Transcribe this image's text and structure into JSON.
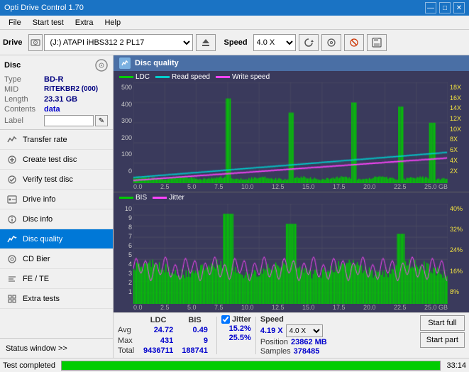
{
  "titlebar": {
    "title": "Opti Drive Control 1.70",
    "min_btn": "—",
    "max_btn": "□",
    "close_btn": "✕"
  },
  "menubar": {
    "items": [
      "File",
      "Start test",
      "Extra",
      "Help"
    ]
  },
  "toolbar": {
    "drive_label": "Drive",
    "drive_value": "(J:)  ATAPI iHBS312  2 PL17",
    "speed_label": "Speed",
    "speed_value": "4.0 X"
  },
  "disc": {
    "title": "Disc",
    "type_label": "Type",
    "type_value": "BD-R",
    "mid_label": "MID",
    "mid_value": "RITEKBR2 (000)",
    "length_label": "Length",
    "length_value": "23.31 GB",
    "contents_label": "Contents",
    "contents_value": "data",
    "label_label": "Label"
  },
  "nav": {
    "items": [
      {
        "id": "transfer-rate",
        "label": "Transfer rate",
        "active": false
      },
      {
        "id": "create-test-disc",
        "label": "Create test disc",
        "active": false
      },
      {
        "id": "verify-test-disc",
        "label": "Verify test disc",
        "active": false
      },
      {
        "id": "drive-info",
        "label": "Drive info",
        "active": false
      },
      {
        "id": "disc-info",
        "label": "Disc info",
        "active": false
      },
      {
        "id": "disc-quality",
        "label": "Disc quality",
        "active": true
      },
      {
        "id": "cd-bier",
        "label": "CD Bier",
        "active": false
      },
      {
        "id": "fe-te",
        "label": "FE / TE",
        "active": false
      },
      {
        "id": "extra-tests",
        "label": "Extra tests",
        "active": false
      }
    ]
  },
  "status_window": {
    "label": "Status window >>"
  },
  "disc_quality": {
    "title": "Disc quality"
  },
  "chart_top": {
    "legend": [
      {
        "id": "ldc",
        "label": "LDC",
        "color": "#00cc00"
      },
      {
        "id": "read-speed",
        "label": "Read speed",
        "color": "#00cccc"
      },
      {
        "id": "write-speed",
        "label": "Write speed",
        "color": "#ff44ff"
      }
    ],
    "y_labels_left": [
      "500",
      "400",
      "300",
      "200",
      "100",
      "0"
    ],
    "y_labels_right": [
      "18X",
      "16X",
      "14X",
      "12X",
      "10X",
      "8X",
      "6X",
      "4X",
      "2X"
    ],
    "x_labels": [
      "0.0",
      "2.5",
      "5.0",
      "7.5",
      "10.0",
      "12.5",
      "15.0",
      "17.5",
      "20.0",
      "22.5",
      "25.0 GB"
    ]
  },
  "chart_bottom": {
    "legend": [
      {
        "id": "bis",
        "label": "BIS",
        "color": "#00cc00"
      },
      {
        "id": "jitter",
        "label": "Jitter",
        "color": "#ff44ff"
      }
    ],
    "y_labels_left": [
      "10",
      "9",
      "8",
      "7",
      "6",
      "5",
      "4",
      "3",
      "2",
      "1"
    ],
    "y_labels_right": [
      "40%",
      "32%",
      "24%",
      "16%",
      "8%"
    ],
    "x_labels": [
      "0.0",
      "2.5",
      "5.0",
      "7.5",
      "10.0",
      "12.5",
      "15.0",
      "17.5",
      "20.0",
      "22.5",
      "25.0 GB"
    ]
  },
  "stats": {
    "ldc_label": "LDC",
    "bis_label": "BIS",
    "jitter_label": "Jitter",
    "speed_label": "Speed",
    "avg_label": "Avg",
    "avg_ldc": "24.72",
    "avg_bis": "0.49",
    "avg_jitter": "15.2%",
    "avg_speed": "4.19 X",
    "max_label": "Max",
    "max_ldc": "431",
    "max_bis": "9",
    "max_jitter": "25.5%",
    "max_speed_label": "Position",
    "max_speed_val": "23862 MB",
    "total_label": "Total",
    "total_ldc": "9436711",
    "total_bis": "188741",
    "total_jitter": "",
    "samples_label": "Samples",
    "samples_val": "378485",
    "speed_select": "4.0 X",
    "start_full": "Start full",
    "start_part": "Start part",
    "jitter_checked": true
  },
  "statusbar": {
    "text": "Test completed",
    "progress": 100,
    "time": "33:14"
  }
}
